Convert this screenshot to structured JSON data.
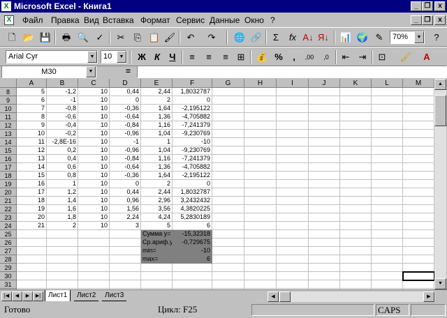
{
  "window": {
    "title": "Microsoft Excel - Книга1",
    "min": "_",
    "restore": "❐",
    "close": "x"
  },
  "menu": [
    "Файл",
    "Правка",
    "Вид",
    "Вставка",
    "Формат",
    "Сервис",
    "Данные",
    "Окно",
    "?"
  ],
  "toolbar": {
    "zoom": "70%",
    "font": "Arial Cyr",
    "size": "10",
    "bold": "Ж",
    "italic": "К",
    "underline": "Ч",
    "percent": "%",
    "comma": ",",
    "sigma": "Σ",
    "fx": "fx"
  },
  "namebox": "M30",
  "formula_eq": "=",
  "columns": [
    "A",
    "B",
    "C",
    "D",
    "E",
    "F",
    "G",
    "H",
    "I",
    "J",
    "K",
    "L",
    "M"
  ],
  "rows": [
    {
      "n": "8",
      "c": [
        "5",
        "-1,2",
        "10",
        "0,44",
        "2,44",
        "1,8032787"
      ]
    },
    {
      "n": "9",
      "c": [
        "6",
        "-1",
        "10",
        "0",
        "2",
        "0"
      ]
    },
    {
      "n": "10",
      "c": [
        "7",
        "-0,8",
        "10",
        "-0,36",
        "1,64",
        "-2,195122"
      ]
    },
    {
      "n": "11",
      "c": [
        "8",
        "-0,6",
        "10",
        "-0,64",
        "1,36",
        "-4,705882"
      ]
    },
    {
      "n": "12",
      "c": [
        "9",
        "-0,4",
        "10",
        "-0,84",
        "1,16",
        "-7,241379"
      ]
    },
    {
      "n": "13",
      "c": [
        "10",
        "-0,2",
        "10",
        "-0,96",
        "1,04",
        "-9,230769"
      ]
    },
    {
      "n": "14",
      "c": [
        "11",
        "-2,8E-16",
        "10",
        "-1",
        "1",
        "-10"
      ]
    },
    {
      "n": "15",
      "c": [
        "12",
        "0,2",
        "10",
        "-0,96",
        "1,04",
        "-9,230769"
      ]
    },
    {
      "n": "16",
      "c": [
        "13",
        "0,4",
        "10",
        "-0,84",
        "1,16",
        "-7,241379"
      ]
    },
    {
      "n": "17",
      "c": [
        "14",
        "0,6",
        "10",
        "-0,64",
        "1,36",
        "-4,705882"
      ]
    },
    {
      "n": "18",
      "c": [
        "15",
        "0,8",
        "10",
        "-0,36",
        "1,64",
        "-2,195122"
      ]
    },
    {
      "n": "19",
      "c": [
        "16",
        "1",
        "10",
        "0",
        "2",
        "0"
      ]
    },
    {
      "n": "20",
      "c": [
        "17",
        "1,2",
        "10",
        "0,44",
        "2,44",
        "1,8032787"
      ]
    },
    {
      "n": "21",
      "c": [
        "18",
        "1,4",
        "10",
        "0,96",
        "2,96",
        "3,2432432"
      ]
    },
    {
      "n": "22",
      "c": [
        "19",
        "1,6",
        "10",
        "1,56",
        "3,56",
        "4,3820225"
      ]
    },
    {
      "n": "23",
      "c": [
        "20",
        "1,8",
        "10",
        "2,24",
        "4,24",
        "5,2830189"
      ]
    },
    {
      "n": "24",
      "c": [
        "21",
        "2",
        "10",
        "3",
        "5",
        "6"
      ]
    },
    {
      "n": "25",
      "c": [
        "",
        "",
        "",
        "",
        "Сумма у=",
        "-15,32318"
      ]
    },
    {
      "n": "26",
      "c": [
        "",
        "",
        "",
        "",
        "Ср.ариф.у=",
        "-0,729675"
      ]
    },
    {
      "n": "27",
      "c": [
        "",
        "",
        "",
        "",
        "min=",
        "-10"
      ]
    },
    {
      "n": "28",
      "c": [
        "",
        "",
        "",
        "",
        "max=",
        "6"
      ]
    },
    {
      "n": "29",
      "c": [
        "",
        "",
        "",
        "",
        "",
        ""
      ]
    },
    {
      "n": "30",
      "c": [
        "",
        "",
        "",
        "",
        "",
        ""
      ]
    },
    {
      "n": "31",
      "c": [
        "",
        "",
        "",
        "",
        "",
        ""
      ]
    },
    {
      "n": "32",
      "c": [
        "",
        "",
        "",
        "",
        "",
        ""
      ]
    }
  ],
  "sheets": [
    "Лист1",
    "Лист2",
    "Лист3"
  ],
  "status": {
    "ready": "Готово",
    "cycle": "Цикл: F25",
    "caps": "CAPS"
  }
}
